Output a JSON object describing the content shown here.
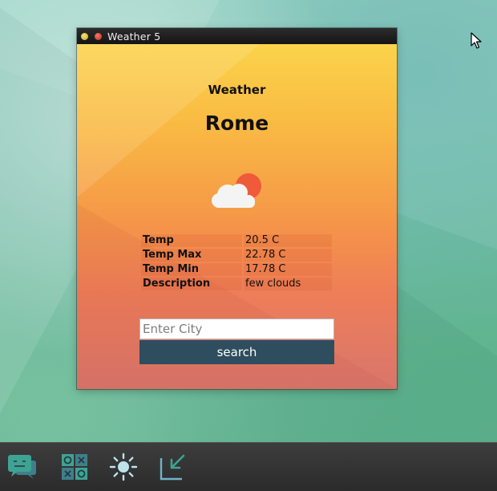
{
  "window": {
    "title": "Weather 5"
  },
  "weather": {
    "app_label": "Weather",
    "city": "Rome",
    "icon": "few-clouds-icon",
    "rows": [
      {
        "label": "Temp",
        "value": "20.5 C"
      },
      {
        "label": "Temp Max",
        "value": "22.78 C"
      },
      {
        "label": "Temp Min",
        "value": "17.78 C"
      },
      {
        "label": "Description",
        "value": "few clouds"
      }
    ]
  },
  "search": {
    "placeholder": "Enter City",
    "value": "",
    "button_label": "search"
  },
  "taskbar": {
    "items": [
      {
        "name": "chat-icon"
      },
      {
        "name": "tic-tac-toe-icon"
      },
      {
        "name": "brightness-icon"
      },
      {
        "name": "minimize-window-icon"
      }
    ]
  },
  "colors": {
    "button": "#2e4d5e",
    "titlebar": "#1a1a1a",
    "taskbar": "#333333"
  }
}
